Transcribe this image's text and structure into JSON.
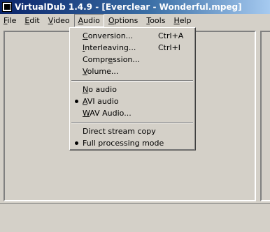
{
  "window": {
    "title": "VirtualDub 1.4.9 - [Everclear - Wonderful.mpeg]",
    "icon": "app-icon"
  },
  "menubar": {
    "items": [
      {
        "mnemonic": "F",
        "rest": "ile"
      },
      {
        "mnemonic": "E",
        "rest": "dit"
      },
      {
        "mnemonic": "V",
        "rest": "ideo"
      },
      {
        "mnemonic": "A",
        "rest": "udio"
      },
      {
        "mnemonic": "O",
        "rest": "ptions"
      },
      {
        "mnemonic": "T",
        "rest": "ools"
      },
      {
        "mnemonic": "H",
        "rest": "elp"
      }
    ],
    "open_menu": "Audio"
  },
  "audio_menu": {
    "items": [
      {
        "pre": "",
        "mnemonic": "C",
        "post": "onversion...",
        "shortcut": "Ctrl+A"
      },
      {
        "pre": "",
        "mnemonic": "I",
        "post": "nterleaving...",
        "shortcut": "Ctrl+I"
      },
      {
        "pre": "Compr",
        "mnemonic": "e",
        "post": "ssion...",
        "shortcut": ""
      },
      {
        "pre": "",
        "mnemonic": "V",
        "post": "olume...",
        "shortcut": ""
      },
      {
        "pre": "",
        "mnemonic": "N",
        "post": "o audio",
        "shortcut": ""
      },
      {
        "pre": "",
        "mnemonic": "A",
        "post": "VI audio",
        "shortcut": "",
        "checked": true
      },
      {
        "pre": "",
        "mnemonic": "W",
        "post": "AV Audio...",
        "shortcut": ""
      },
      {
        "pre": "Direct stream copy",
        "mnemonic": "",
        "post": "",
        "shortcut": ""
      },
      {
        "pre": "Full processing mode",
        "mnemonic": "",
        "post": "",
        "shortcut": "",
        "checked": true
      }
    ]
  }
}
